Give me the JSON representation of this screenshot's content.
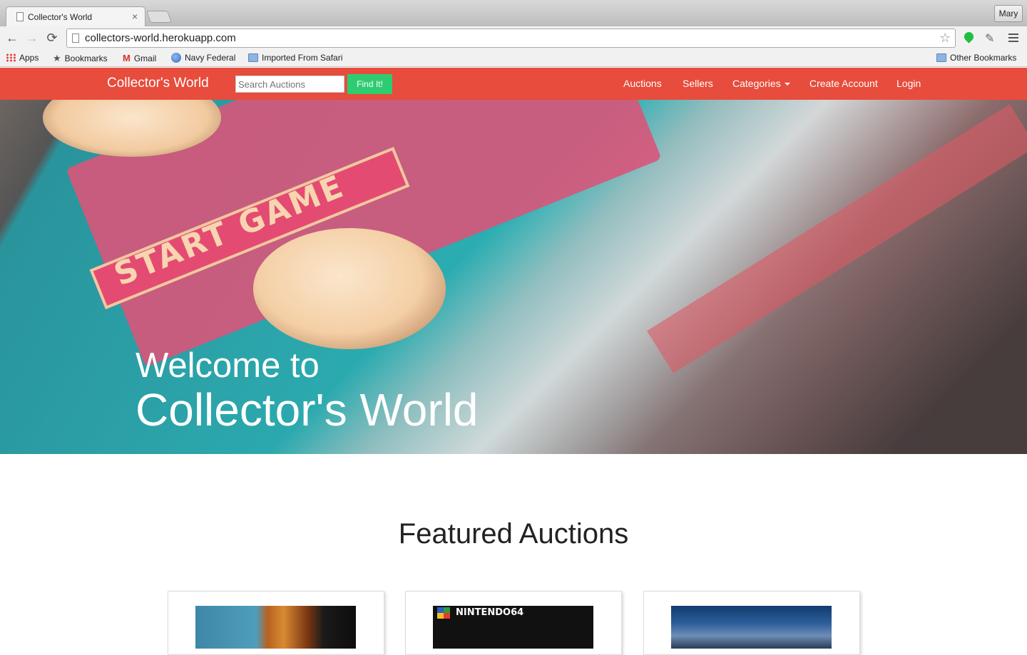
{
  "browser": {
    "tab_title": "Collector's World",
    "tab_close": "×",
    "profile": "Mary",
    "url": "collectors-world.herokuapp.com",
    "back": "←",
    "forward": "→",
    "reload": "⟳",
    "star": "☆",
    "dropper": "✎",
    "bookmarks": [
      "Apps",
      "Bookmarks",
      "Gmail",
      "Navy Federal",
      "Imported From Safari"
    ],
    "other_bookmarks": "Other Bookmarks",
    "bookmark_star": "★",
    "gmail_mark": "M"
  },
  "site": {
    "brand": "Collector's World",
    "search_placeholder": "Search Auctions",
    "find_button": "Find It!",
    "nav": [
      "Auctions",
      "Sellers",
      "Categories",
      "Create Account",
      "Login"
    ]
  },
  "hero": {
    "welcome": "Welcome to",
    "title": "Collector's World",
    "ribbon_text": "START GAME"
  },
  "featured": {
    "heading": "Featured Auctions",
    "cards": [
      {
        "image": "guitar"
      },
      {
        "image": "nintendo-64-game",
        "label": "NINTENDO64"
      },
      {
        "image": "electronics"
      }
    ]
  },
  "colors": {
    "navbar": "#e74c3c",
    "find_button": "#2ecc71"
  }
}
